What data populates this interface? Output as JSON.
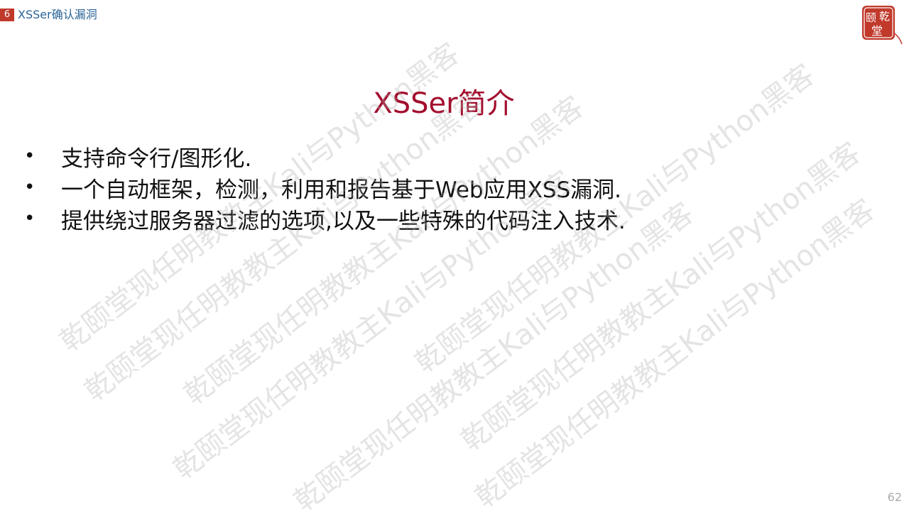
{
  "header": {
    "section_number": "6",
    "section_title": "XSSer确认漏洞"
  },
  "logo": {
    "text_top": "乾",
    "text_left": "颐",
    "text_bottom": "堂",
    "color": "#c0392b"
  },
  "slide": {
    "title": "XSSer简介",
    "bullets": [
      "支持命令行/图形化.",
      "一个自动框架，检测，利用和报告基于Web应用XSS漏洞.",
      "提供绕过服务器过滤的选项,以及一些特殊的代码注入技术."
    ]
  },
  "watermark": {
    "text": "乾颐堂现任明教教主Kali与Python黑客"
  },
  "footer": {
    "page_number": "62"
  }
}
